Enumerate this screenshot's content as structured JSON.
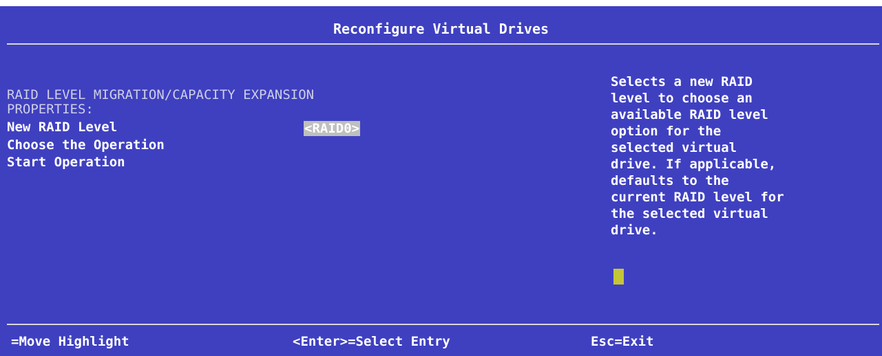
{
  "colors": {
    "background": "#3f40c0",
    "text": "#ffffff",
    "dim_text": "#cfcfe6",
    "highlight": "#bfbfbf",
    "cursor": "#c5c53a",
    "rule": "#d8d8d8"
  },
  "header": {
    "title": "Reconfigure Virtual Drives"
  },
  "main": {
    "section_title_line1": "RAID LEVEL MIGRATION/CAPACITY EXPANSION",
    "section_title_line2": "PROPERTIES:",
    "items": [
      {
        "label": "New RAID Level",
        "value": "<RAID0>"
      },
      {
        "label": "Choose the Operation"
      },
      {
        "label": "Start Operation"
      }
    ]
  },
  "help": {
    "lines": [
      "Selects a new RAID",
      "level to choose an",
      "available RAID level",
      "option for the",
      "selected virtual",
      "drive. If applicable,",
      "defaults to the",
      "current RAID level for",
      "the selected virtual",
      "drive."
    ]
  },
  "footer": {
    "move": "=Move Highlight",
    "select": "<Enter>=Select Entry",
    "exit": "Esc=Exit"
  }
}
